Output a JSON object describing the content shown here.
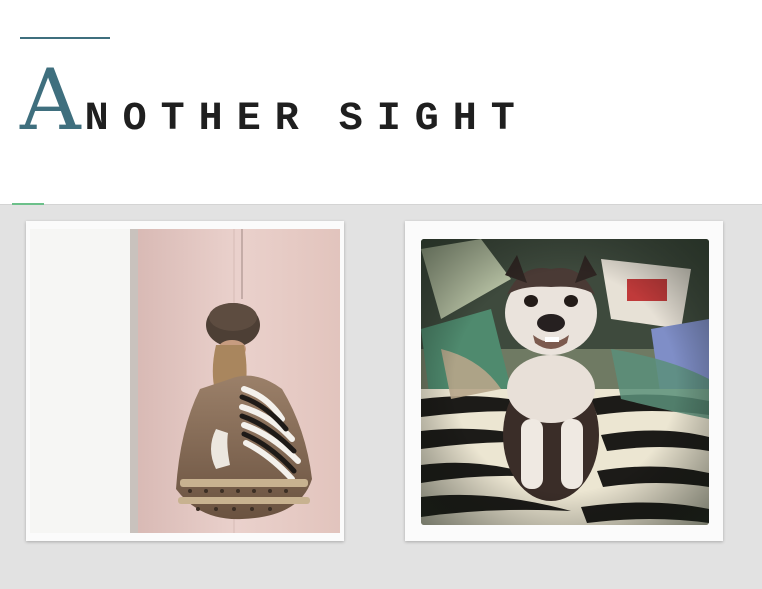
{
  "header": {
    "logo_initial": "A",
    "logo_word1": "NOTHER",
    "logo_word2": "SIGHT",
    "accent_color": "#3f6f7e"
  },
  "gallery": {
    "background": "#e2e2e2",
    "items": [
      {
        "icon": "photo-fur-coat-woman"
      },
      {
        "icon": "photo-bulldog"
      }
    ]
  }
}
